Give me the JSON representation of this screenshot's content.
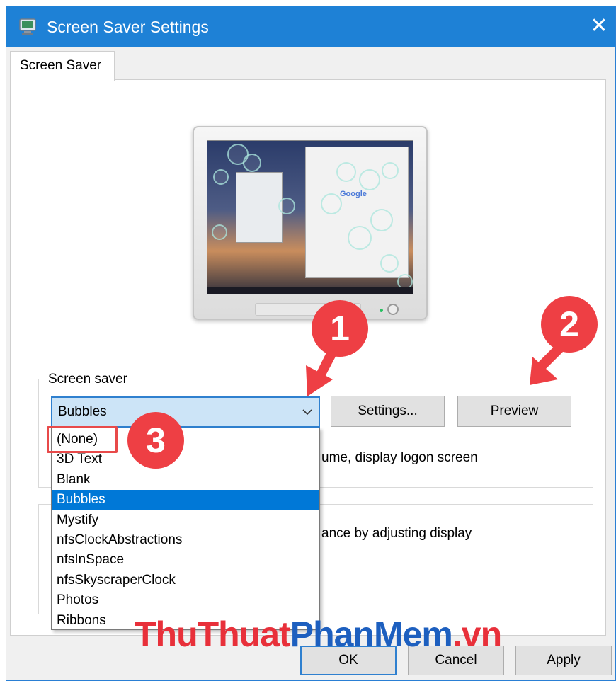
{
  "window": {
    "title": "Screen Saver Settings",
    "close_symbol": "✕"
  },
  "tabs": [
    {
      "label": "Screen Saver"
    }
  ],
  "preview": {
    "screen_text": "Google"
  },
  "screen_saver_group": {
    "label": "Screen saver",
    "selected": "Bubbles",
    "settings_label": "Settings...",
    "preview_label": "Preview",
    "resume_text_fragment": "ume, display logon screen"
  },
  "power_group": {
    "text_fragment": "ance by adjusting display"
  },
  "dropdown": {
    "options": [
      "(None)",
      "3D Text",
      "Blank",
      "Bubbles",
      "Mystify",
      "nfsClockAbstractions",
      "nfsInSpace",
      "nfsSkyscraperClock",
      "Photos",
      "Ribbons"
    ],
    "selected_index": 3
  },
  "footer": {
    "ok_label": "OK",
    "cancel_label": "Cancel",
    "apply_label": "Apply"
  },
  "annotations": {
    "badges": [
      "1",
      "2",
      "3"
    ],
    "color": "#ee3f44"
  },
  "watermark": {
    "red_part": "ThuThuat",
    "blue_part": "PhanMem",
    "red_suffix": ".vn"
  },
  "colors": {
    "titlebar": "#1e81d6",
    "accent": "#0078d7",
    "combo_bg": "#cce4f7"
  }
}
